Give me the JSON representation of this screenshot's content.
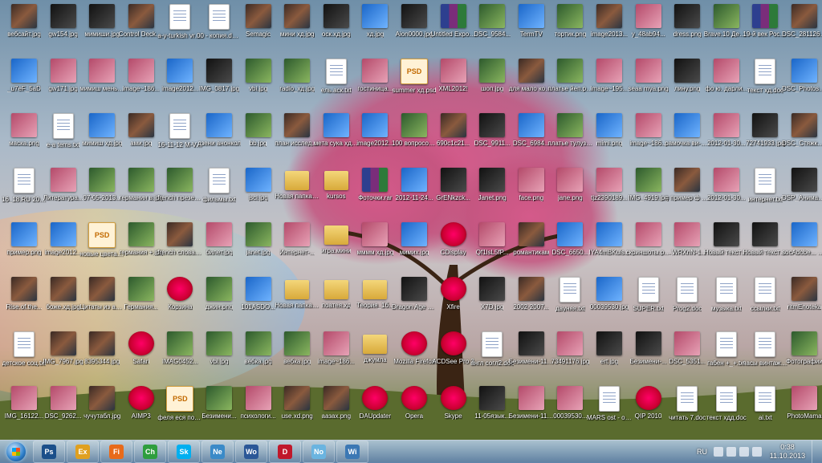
{
  "desktop": {
    "columns": [
      [
        "вебсайт.jpg",
        "_u7eF_5aD",
        "маска.png",
        "16_18.RU 20.docx",
        "пример.png",
        "Rise.of.the...",
        "детское соц.txt",
        "IMG_16122..."
      ],
      [
        "gw154.jpg",
        "gw171.jpg",
        "е-а tems.txt",
        "Литература...",
        "image2012...",
        "боже.хд.jpg",
        "IMG_7967.jpg",
        "DSC_9262..."
      ],
      [
        "мимиши.jpg",
        "мимиш меньше.png",
        "мимиш хд.jpg",
        "07-05-2013...",
        "новые цвета клетка.psd",
        "Цитаты из английских...",
        "8395344.jpg",
        "чучутабл.jpg"
      ],
      [
        "Control Deck Рагнарок",
        "image~186...",
        "ами.jpg",
        "германия в.jpg",
        "германия +.jpg",
        "Германия...",
        "Safari",
        "AIMP3"
      ],
      [
        "а-у-turkish vrachi.txt",
        "image2012...",
        "16-11-12 M-V.text.txt",
        "french презентац...",
        "french слова презентац...",
        "Корзина",
        "IMAG0452...",
        "феля еся подарок.psd"
      ],
      [
        "00 - копия.docx",
        "IMG_0817.jpg",
        "дзени анонкол",
        "фильмы.txt",
        "билет.jpg",
        "джин.png",
        "vbi.jpg",
        "Безимени..."
      ],
      [
        "Semagic",
        "vbi.jpg",
        "bb.jpg",
        "jsci.jpg",
        "janet.jpg",
        "101ASDO...",
        "вебка.jpg",
        "психологи..."
      ],
      [
        "мини хд.jpg",
        "radio_хд.jpg",
        "план исследования",
        "Новая папка (2)",
        "Интернет-...",
        "Новая папка (3)",
        "вебка.jpg",
        "use.xd.png"
      ],
      [
        "оск.хд.jpg",
        "ель.аск.txt",
        "мета сука хд.jpg",
        "kursos",
        "игра.мини",
        "поатея.хд",
        "image~186...",
        "аазах.png"
      ],
      [
        "хд.jpg",
        "гостиница...",
        "image2012...",
        "Фоточки.rar",
        "мммм хд.jpg",
        "Теория_1б...",
        "джумла",
        "DAUpdater"
      ],
      [
        "Aion0000.jpg",
        "summer хд.psd",
        "100 вопросов...",
        "2012-11-24...",
        "мимих.jpg",
        "Dragon Age Начало",
        "Mozilla Firefox",
        "Opera"
      ],
      [
        "Untitled Export.rar",
        "XML2012!",
        "690c1c21...",
        "GrENkzck...",
        "CDisplay",
        "Xfire",
        "ACDSee Pro 3",
        "Skype"
      ],
      [
        "DSC_9584...",
        "шоп.jpg",
        "DSC_9911...",
        "Janet.png",
        "Qf1lsL5fP...",
        "X7D.jpg",
        "англ согл2.doc",
        "11-05язык..."
      ],
      [
        "TermTV",
        "для мало копия.png",
        "DSC_6984...",
        "face.png",
        "романтикам",
        "2002-2007...",
        "Безимени-11 копия.jpg",
        "Безимени-11 копия.png"
      ],
      [
        "тортик.png",
        "платье йеп.png",
        "платье тулуз.png",
        "jane.png",
        "DSC_6650...",
        "дауняя.txt",
        "73491176.jpg",
        "00039530..."
      ],
      [
        "image2013...",
        "image~195...",
        "mimi.png",
        "tjz2390189...",
        "IYA4mBKuls...",
        "00039530.jpg",
        "ert.jpg",
        "MARS ost - opening.mp3"
      ],
      [
        "y_48ab94...",
        "seaa mya.png",
        "image~186...",
        "IMG_4919.jpg",
        "скриншоты.png",
        "SUPER.txt",
        "Безимени-...",
        "QIP 2010"
      ],
      [
        "dress.png",
        "лину.png",
        "рамочка ви-не...",
        "= пример ф хд.jpg",
        "_WRXnN-1...",
        "Prog2.doc",
        "DSC_5351...",
        "читать 7.doc"
      ],
      [
        "Brave.10 Десятка от...",
        "фо ю. дарли...",
        "2012-01-30...",
        "2012-01-30...",
        "Новый текстовый...",
        "музыка.txt",
        "габен +_+.txt",
        "текст хдд.doc"
      ],
      [
        "19-й век Россия.rar",
        "текст хд.doc",
        "72741933.jpg",
        "интернет.txt",
        "Новый текстовый...",
        "ссылки.txt",
        "часы винтаж дизайн.txt",
        "ai.txt"
      ],
      [
        "DSC_2811262 Chrome",
        "DSC_Photoshop",
        "DSC_Стяжки костюмы",
        "DSP_Анимация",
        "socAdobe... австрали...",
        "ritmEnoteka",
        "Фотографии",
        "PhotoMama"
      ]
    ]
  },
  "taskbar": {
    "buttons": [
      "Ps",
      "Explorer",
      "Firefox",
      "Chrome",
      "Skype",
      "Network",
      "Word",
      "D",
      "Notes",
      "Window"
    ],
    "lang": "RU",
    "time": "0:38",
    "date": "11.10.2013"
  }
}
